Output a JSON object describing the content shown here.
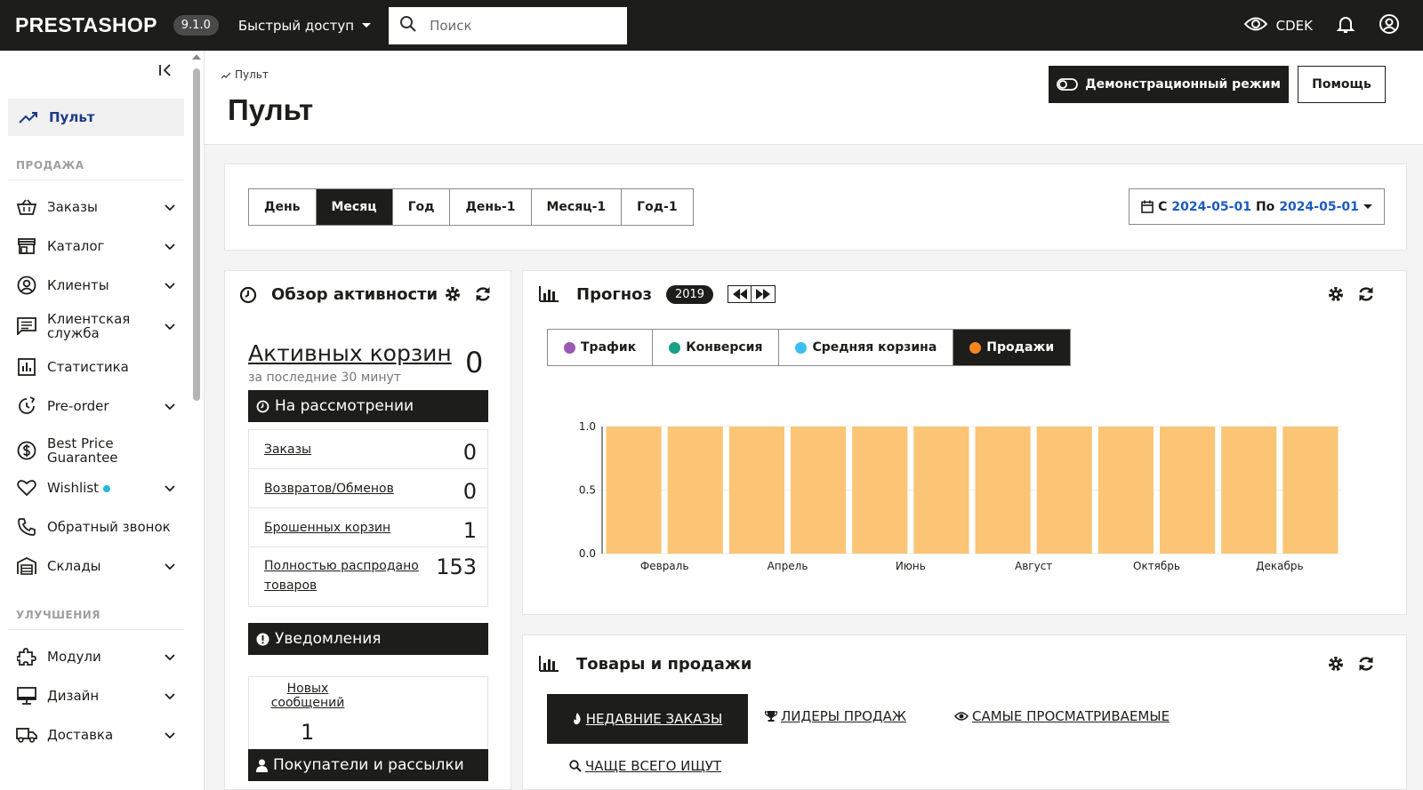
{
  "topbar": {
    "logo": "PRESTASHOP",
    "version": "9.1.0",
    "quick_access": "Быстрый доступ",
    "search_placeholder": "Поиск",
    "shop_name": "CDEK"
  },
  "sidebar": {
    "active": "Пульт",
    "section_sales": "ПРОДАЖА",
    "section_improve": "УЛУЧШЕНИЯ",
    "items": [
      {
        "label": "Заказы",
        "icon": "basket-icon",
        "chevron": true
      },
      {
        "label": "Каталог",
        "icon": "store-icon",
        "chevron": true
      },
      {
        "label": "Клиенты",
        "icon": "user-circle-icon",
        "chevron": true
      },
      {
        "label": "Клиентская служба",
        "icon": "chat-icon",
        "chevron": true
      },
      {
        "label": "Статистика",
        "icon": "stats-icon",
        "chevron": false
      },
      {
        "label": "Pre-order",
        "icon": "clock-arrow-icon",
        "chevron": true
      },
      {
        "label": "Best Price Guarantee",
        "icon": "dollar-icon",
        "chevron": false
      },
      {
        "label": "Wishlist",
        "icon": "heart-icon",
        "chevron": true
      },
      {
        "label": "Обратный звонок",
        "icon": "phone-icon",
        "chevron": false
      },
      {
        "label": "Склады",
        "icon": "warehouse-icon",
        "chevron": true
      }
    ],
    "items_improve": [
      {
        "label": "Модули",
        "icon": "puzzle-icon",
        "chevron": true
      },
      {
        "label": "Дизайн",
        "icon": "monitor-icon",
        "chevron": true
      },
      {
        "label": "Доставка",
        "icon": "truck-icon",
        "chevron": true
      }
    ]
  },
  "header": {
    "breadcrumb": "Пульт",
    "title": "Пульт",
    "demo_button": "Демонстрационный режим",
    "help_button": "Помощь"
  },
  "period": {
    "buttons": [
      "День",
      "Месяц",
      "Год",
      "День-1",
      "Месяц-1",
      "Год-1"
    ],
    "active": "Месяц",
    "from_label": "С",
    "from": "2024-05-01",
    "to_label": "По",
    "to": "2024-05-01"
  },
  "activity": {
    "title": "Обзор активности",
    "active_carts_label": "Активных корзин",
    "active_carts_sub": "за последние 30 минут",
    "active_carts_value": "0",
    "pending_title": "На рассмотрении",
    "pending": [
      {
        "label": "Заказы",
        "value": "0"
      },
      {
        "label": "Возвратов/Обменов",
        "value": "0"
      },
      {
        "label": "Брошенных корзин",
        "value": "1"
      },
      {
        "label": "Полностью распродано товаров",
        "value": "153"
      }
    ],
    "notifications_title": "Уведомления",
    "new_messages_label": "Новых сообщений",
    "new_messages_value": "1",
    "customers_title": "Покупатели и рассылки"
  },
  "forecast": {
    "title": "Прогноз",
    "year": "2019",
    "metrics": [
      {
        "label": "Трафик",
        "color": "#9b59b6"
      },
      {
        "label": "Конверсия",
        "color": "#16a085"
      },
      {
        "label": "Средняя корзина",
        "color": "#3abff0"
      },
      {
        "label": "Продажи",
        "color": "#f5861f"
      }
    ],
    "active_metric": "Продажи"
  },
  "chart_data": {
    "type": "bar",
    "categories": [
      "",
      "Февраль",
      "",
      "Апрель",
      "",
      "Июнь",
      "",
      "Август",
      "",
      "Октябрь",
      "",
      "Декабрь"
    ],
    "values": [
      1,
      1,
      1,
      1,
      1,
      1,
      1,
      1,
      1,
      1,
      1,
      1
    ],
    "ylim": [
      0,
      1
    ],
    "yticks": [
      "1.0",
      "0.5",
      "0.0"
    ],
    "bar_color": "#fbc575"
  },
  "products": {
    "title": "Товары и продажи",
    "tabs": [
      "НЕДАВНИЕ ЗАКАЗЫ",
      "ЛИДЕРЫ ПРОДАЖ",
      "САМЫЕ ПРОСМАТРИВАЕМЫЕ",
      "ЧАЩЕ ВСЕГО ИЩУТ"
    ]
  }
}
